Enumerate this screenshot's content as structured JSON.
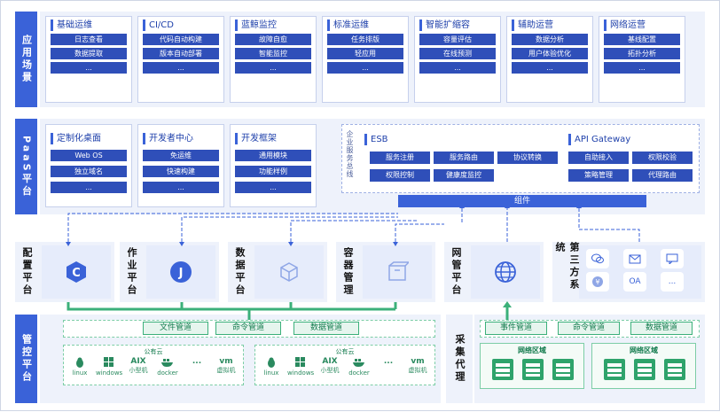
{
  "scenarios": {
    "label": "应用场景",
    "cards": [
      {
        "title": "基础运维",
        "items": [
          "日志查看",
          "数据提取",
          "..."
        ]
      },
      {
        "title": "CI/CD",
        "items": [
          "代码自动构建",
          "版本自动部署",
          "..."
        ]
      },
      {
        "title": "蓝鲸监控",
        "items": [
          "故障自愈",
          "智能监控",
          "..."
        ]
      },
      {
        "title": "标准运维",
        "items": [
          "任务排版",
          "轻应用",
          "..."
        ]
      },
      {
        "title": "智能扩缩容",
        "items": [
          "容量评估",
          "在线预测",
          "..."
        ]
      },
      {
        "title": "辅助运营",
        "items": [
          "数据分析",
          "用户体验优化",
          "..."
        ]
      },
      {
        "title": "网络运营",
        "items": [
          "基线配置",
          "拓扑分析",
          "..."
        ]
      }
    ]
  },
  "paas": {
    "label": "PaaS平台",
    "cards": [
      {
        "title": "定制化桌面",
        "items": [
          "Web OS",
          "独立域名",
          "..."
        ]
      },
      {
        "title": "开发者中心",
        "items": [
          "免运维",
          "快速构建",
          "..."
        ]
      },
      {
        "title": "开发框架",
        "items": [
          "通用模块",
          "功能样例",
          "..."
        ]
      }
    ],
    "esb_group": {
      "side_label": "企业服务总线",
      "esb": {
        "title": "ESB",
        "items": [
          "服务注册",
          "服务路由",
          "协议转换",
          "权限控制",
          "健康度监控"
        ]
      },
      "api": {
        "title": "API Gateway",
        "items": [
          "自助接入",
          "权限校验",
          "策略管理",
          "代理路由"
        ]
      },
      "component_label": "组件"
    }
  },
  "middle": {
    "modules": [
      {
        "label": "配置平台",
        "icon": "c-logo-icon"
      },
      {
        "label": "作业平台",
        "icon": "j-logo-icon"
      },
      {
        "label": "数据平台",
        "icon": "cube-icon"
      },
      {
        "label": "容器管理",
        "icon": "container-icon"
      },
      {
        "label": "网管平台",
        "icon": "globe-icon"
      }
    ],
    "third_party": {
      "label": "第三方系统",
      "apps": [
        "wechat-icon",
        "mail-icon",
        "chat-icon",
        "yen-icon",
        "OA",
        "..."
      ]
    }
  },
  "control": {
    "label": "管控平台",
    "channels": [
      "文件管道",
      "命令管道",
      "数据管道"
    ],
    "clouds": [
      {
        "title": "公有云",
        "os": [
          "linux",
          "windows",
          "AIX\n小型机",
          "docker",
          "...",
          "vm\n虚拟机"
        ]
      },
      {
        "title": "公有云",
        "os": [
          "linux",
          "windows",
          "AIX\n小型机",
          "docker",
          "...",
          "vm\n虚拟机"
        ]
      }
    ]
  },
  "collector": {
    "label": "采集代理",
    "channels": [
      "事件管道",
      "命令管道",
      "数据管道"
    ],
    "zones": [
      {
        "title": "网络区域"
      },
      {
        "title": "网络区域"
      }
    ]
  },
  "colors": {
    "primary": "#3a62d8",
    "green": "#3bb07a",
    "band": "#eef2fb"
  }
}
